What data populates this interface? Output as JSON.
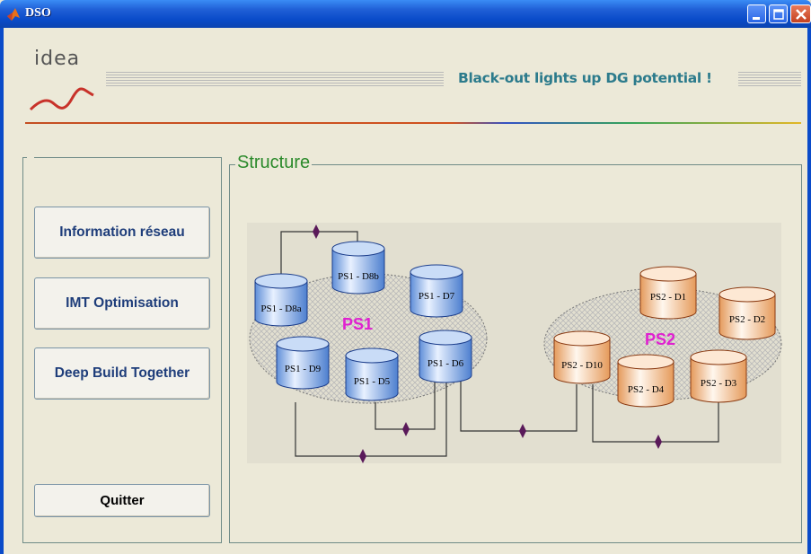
{
  "window": {
    "title": "DSO",
    "controls": [
      "minimize",
      "maximize",
      "close"
    ]
  },
  "header": {
    "logo_text": "idea",
    "slogan": "Black-out lights up DG potential !"
  },
  "buttons": {
    "info": "Information réseau",
    "imt": "IMT Optimisation",
    "deep": "Deep Build Together",
    "quit": "Quitter"
  },
  "structure": {
    "title": "Structure",
    "ps1": {
      "label": "PS1",
      "nodes": [
        "PS1 - D8a",
        "PS1 - D8b",
        "PS1 - D7",
        "PS1 - D9",
        "PS1 - D5",
        "PS1 - D6"
      ]
    },
    "ps2": {
      "label": "PS2",
      "nodes": [
        "PS2 - D1",
        "PS2 - D2",
        "PS2 - D10",
        "PS2 - D4",
        "PS2 - D3"
      ]
    }
  },
  "colors": {
    "titlebar": "#0a4bc9",
    "slogan": "#2c7b8c",
    "button_text": "#1e3d7a",
    "structure_title": "#2b8a2b",
    "zone_label": "#e020d0",
    "ps1_cylinder": "#8fb6ee",
    "ps2_cylinder": "#f2c7a0",
    "link_marker": "#5a1a5a"
  }
}
